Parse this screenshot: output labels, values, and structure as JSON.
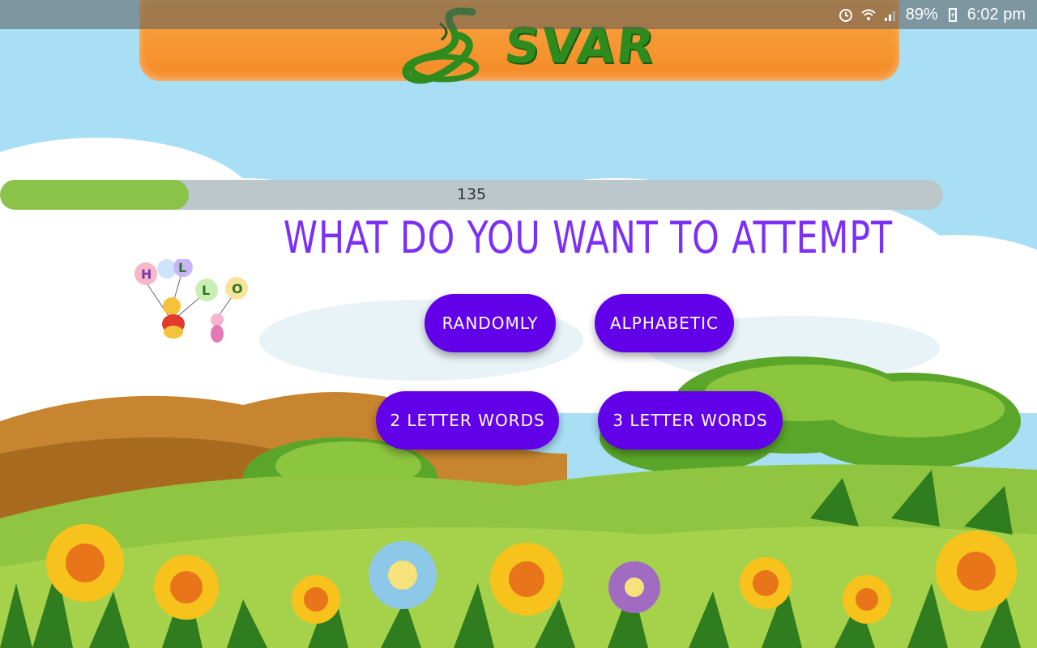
{
  "status_bar": {
    "battery": "89%",
    "time": "6:02 pm",
    "icons": [
      "alarm-icon",
      "wifi-icon",
      "signal-icon",
      "battery-charging-icon"
    ]
  },
  "header": {
    "logo_text": "SVAR",
    "brand_color": "#2e8b1e",
    "banner_color": "#f7a543"
  },
  "progress": {
    "value_label": "135",
    "fill_fraction": 0.2,
    "fill_color": "#8bc34a",
    "track_color": "#bcc7cc"
  },
  "question": {
    "text": "WHAT DO YOU WANT TO ATTEMPT",
    "color": "#7b2ff7"
  },
  "buttons": {
    "randomly": "RANDOMLY",
    "alphabetic": "ALPHABETIC",
    "two_letter": "2 LETTER WORDS",
    "three_letter": "3 LETTER WORDS",
    "color": "#6200ea"
  },
  "hello_art": {
    "letters": [
      "H",
      "L",
      "L",
      "O"
    ]
  }
}
